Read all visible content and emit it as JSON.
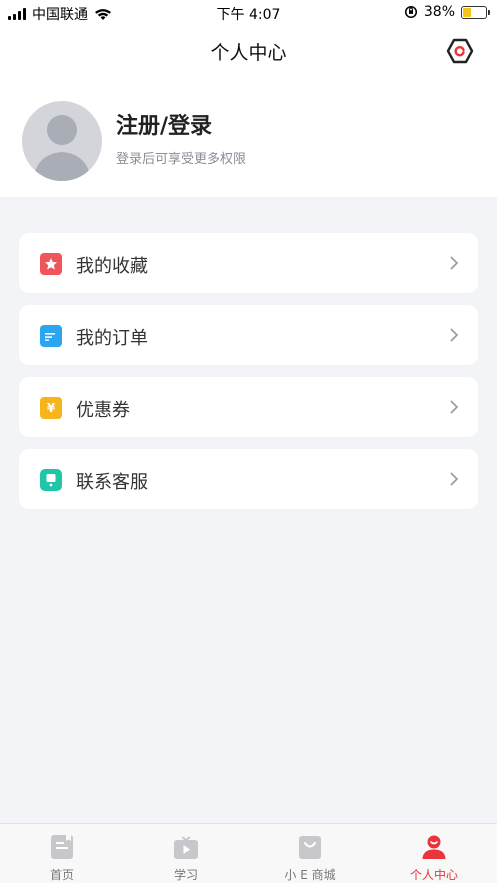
{
  "status_bar": {
    "carrier": "中国联通",
    "time": "下午 4:07",
    "battery_percent": "38%",
    "battery_level": 0.38
  },
  "header": {
    "title": "个人中心",
    "settings_icon": "settings-hexagon-icon"
  },
  "profile": {
    "login_title": "注册/登录",
    "login_subtitle": "登录后可享受更多权限"
  },
  "menu": [
    {
      "label": "我的收藏",
      "icon": "star-icon",
      "color": "#f0555a"
    },
    {
      "label": "我的订单",
      "icon": "order-icon",
      "color": "#2aa5f0"
    },
    {
      "label": "优惠券",
      "icon": "coupon-icon",
      "color": "#f7b51d"
    },
    {
      "label": "联系客服",
      "icon": "service-icon",
      "color": "#1fc7a8"
    }
  ],
  "tabs": [
    {
      "label": "首页",
      "icon": "home-icon"
    },
    {
      "label": "学习",
      "icon": "study-icon"
    },
    {
      "label": "小 E 商城",
      "icon": "shop-icon"
    },
    {
      "label": "个人中心",
      "icon": "profile-icon",
      "active": true
    }
  ],
  "colors": {
    "accent": "#e8343a",
    "background": "#f3f4f8",
    "inactive_tab": "#c8c8cc"
  }
}
